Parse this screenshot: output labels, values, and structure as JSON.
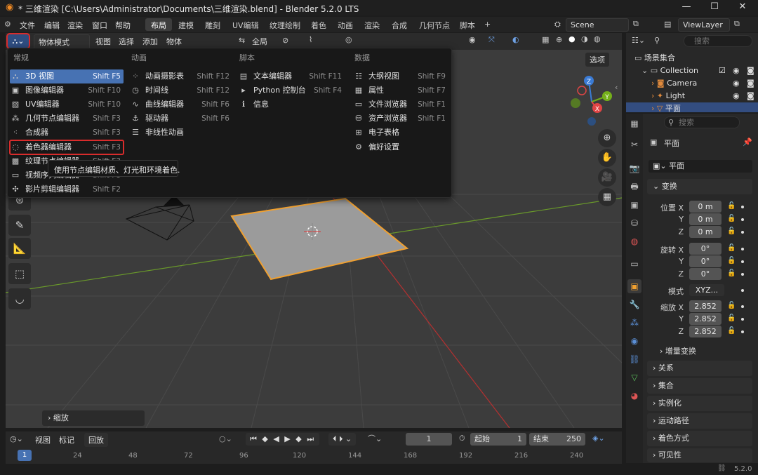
{
  "window": {
    "title": "* 三维渲染 [C:\\Users\\Administrator\\Documents\\三维渲染.blend] - Blender 5.2.0 LTS",
    "min_symbol": "—",
    "max_symbol": "☐",
    "close_symbol": "✕"
  },
  "menubar": {
    "items": [
      "文件",
      "编辑",
      "渲染",
      "窗口",
      "帮助"
    ],
    "workspaces": [
      "布局",
      "建模",
      "雕刻",
      "UV编辑",
      "纹理绘制",
      "着色",
      "动画",
      "渲染",
      "合成",
      "几何节点",
      "脚本"
    ],
    "active_workspace": "布局",
    "add_tab": "+",
    "scene": "Scene",
    "view_layer": "ViewLayer"
  },
  "viewport_header": {
    "mode": "物体模式",
    "menus": [
      "视图",
      "选择",
      "添加",
      "物体"
    ],
    "transform_orientation": "全局",
    "options": "选项"
  },
  "editor_menu": {
    "columns": [
      {
        "heading": "常规",
        "items": [
          {
            "label": "3D 视图",
            "shortcut": "Shift F5",
            "icon": "viewport-icon"
          },
          {
            "label": "图像编辑器",
            "shortcut": "Shift F10",
            "icon": "image-icon"
          },
          {
            "label": "UV编辑器",
            "shortcut": "Shift F10",
            "icon": "uv-icon"
          },
          {
            "label": "几何节点编辑器",
            "shortcut": "Shift F3",
            "icon": "nodes-icon"
          },
          {
            "label": "合成器",
            "shortcut": "Shift F3",
            "icon": "compositor-icon"
          },
          {
            "label": "着色器编辑器",
            "shortcut": "Shift F3",
            "icon": "shader-icon"
          },
          {
            "label": "纹理节点编辑器",
            "shortcut": "Shift F3",
            "icon": "texture-icon"
          },
          {
            "label": "视频序列编辑器",
            "shortcut": "Shift F8",
            "icon": "sequencer-icon"
          },
          {
            "label": "影片剪辑编辑器",
            "shortcut": "Shift F2",
            "icon": "clip-icon"
          }
        ]
      },
      {
        "heading": "动画",
        "items": [
          {
            "label": "动画摄影表",
            "shortcut": "Shift F12",
            "icon": "dopesheet-icon"
          },
          {
            "label": "时间线",
            "shortcut": "Shift F12",
            "icon": "timeline-icon"
          },
          {
            "label": "曲线编辑器",
            "shortcut": "Shift F6",
            "icon": "graph-icon"
          },
          {
            "label": "驱动器",
            "shortcut": "Shift F6",
            "icon": "driver-icon"
          },
          {
            "label": "非线性动画",
            "shortcut": "",
            "icon": "nla-icon"
          }
        ]
      },
      {
        "heading": "脚本",
        "items": [
          {
            "label": "文本编辑器",
            "shortcut": "Shift F11",
            "icon": "text-icon"
          },
          {
            "label": "Python 控制台",
            "shortcut": "Shift F4",
            "icon": "console-icon"
          },
          {
            "label": "信息",
            "shortcut": "",
            "icon": "info-icon"
          }
        ]
      },
      {
        "heading": "数据",
        "items": [
          {
            "label": "大纲视图",
            "shortcut": "Shift F9",
            "icon": "outliner-icon"
          },
          {
            "label": "属性",
            "shortcut": "Shift F7",
            "icon": "properties-icon"
          },
          {
            "label": "文件浏览器",
            "shortcut": "Shift F1",
            "icon": "filebrowser-icon"
          },
          {
            "label": "资产浏览器",
            "shortcut": "Shift F1",
            "icon": "asset-icon"
          },
          {
            "label": "电子表格",
            "shortcut": "",
            "icon": "spreadsheet-icon"
          },
          {
            "label": "偏好设置",
            "shortcut": "",
            "icon": "preferences-icon"
          }
        ]
      }
    ],
    "tooltip": "使用节点编辑材质、灯光和环境着色."
  },
  "viewport": {
    "last_op": "缩放",
    "gizmo": {
      "x": "X",
      "y": "Y",
      "z": "Z"
    }
  },
  "outliner": {
    "search_placeholder": "搜索",
    "root": "场景集合",
    "collection": "Collection",
    "objects": [
      "Camera",
      "Light",
      "平面"
    ]
  },
  "properties": {
    "search_placeholder": "搜索",
    "object_name": "平面",
    "data_name": "平面",
    "transform": {
      "title": "变换",
      "location_label": "位置 X",
      "location": [
        "0 m",
        "0 m",
        "0 m"
      ],
      "rotation_label": "旋转 X",
      "rotation": [
        "0°",
        "0°",
        "0°"
      ],
      "mode_label": "模式",
      "mode": "XYZ...",
      "scale_label": "缩放 X",
      "scale": [
        "2.852",
        "2.852",
        "2.852"
      ],
      "y": "Y",
      "z": "Z",
      "delta": "增量变换"
    },
    "sections": [
      "关系",
      "集合",
      "实例化",
      "运动路径",
      "着色方式",
      "可见性"
    ]
  },
  "timeline": {
    "menus": [
      "视图",
      "标记"
    ],
    "playback": "回放",
    "current_frame": "1",
    "start_label": "起始",
    "start": "1",
    "end_label": "结束",
    "end": "250",
    "ruler": [
      "1",
      "24",
      "48",
      "72",
      "96",
      "120",
      "144",
      "168",
      "192",
      "216",
      "240"
    ]
  },
  "statusbar": {
    "version": "5.2.0"
  },
  "colors": {
    "accent": "#4772b3",
    "highlight_red": "#d92c2c",
    "selection_orange": "#f0a030",
    "axis_red": "#e04545",
    "axis_green": "#74b01a",
    "axis_blue": "#3a7bd5"
  }
}
